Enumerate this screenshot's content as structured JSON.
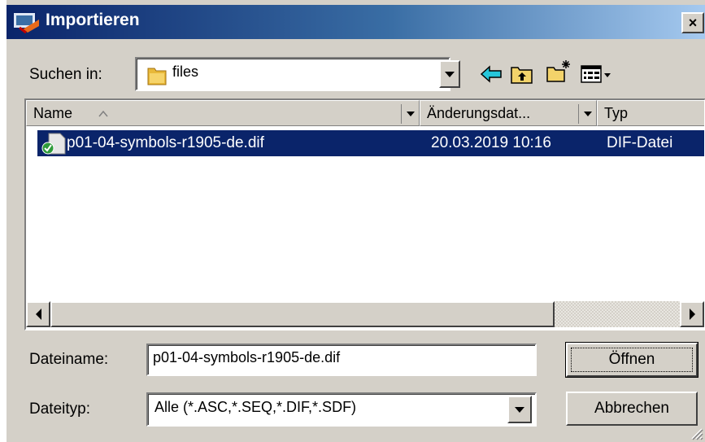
{
  "window": {
    "title": "Importieren",
    "close_glyph": "×"
  },
  "lookin": {
    "label": "Suchen in:",
    "folder": "files",
    "folder_icon": "folder-icon"
  },
  "toolbar": {
    "back_icon": "back-arrow-icon",
    "up_icon": "up-folder-icon",
    "new_folder_icon": "new-folder-icon",
    "view_icon": "view-menu-icon"
  },
  "list": {
    "columns": [
      {
        "label": "Name"
      },
      {
        "label": "Änderungsdat..."
      },
      {
        "label": "Typ"
      }
    ],
    "rows": [
      {
        "name": "p01-04-symbols-r1905-de.dif",
        "modified": "20.03.2019 10:16",
        "type": "DIF-Datei",
        "selected": true
      }
    ],
    "selection_color": "#0a246a"
  },
  "filename": {
    "label": "Dateiname:",
    "value": "p01-04-symbols-r1905-de.dif"
  },
  "filetype": {
    "label": "Dateityp:",
    "value": "Alle (*.ASC,*.SEQ,*.DIF,*.SDF)"
  },
  "buttons": {
    "open": "Öffnen",
    "cancel": "Abbrechen"
  }
}
